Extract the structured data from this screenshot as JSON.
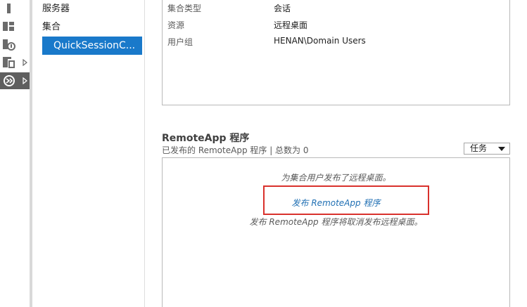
{
  "nav": {
    "items": [
      {
        "label": "服务器"
      },
      {
        "label": "集合"
      },
      {
        "label": "QuickSessionC..."
      }
    ]
  },
  "properties": {
    "rows": [
      {
        "key": "集合类型",
        "value": "会话"
      },
      {
        "key": "资源",
        "value": "远程桌面"
      },
      {
        "key": "用户组",
        "value": "HENAN\\Domain Users"
      }
    ]
  },
  "remoteapp": {
    "title": "RemoteApp 程序",
    "subtitle": "已发布的 RemoteApp 程序 | 总数为 0",
    "tasks_label": "任务",
    "message1": "为集合用户发布了远程桌面。",
    "publish_link": "发布 RemoteApp 程序",
    "message2": "发布 RemoteApp 程序将取消发布远程桌面。"
  },
  "colors": {
    "selection": "#1979ca",
    "link": "#1f6fb3",
    "highlight_border": "#d9312c"
  },
  "icons": [
    "dashboard-icon",
    "local-server-icon",
    "all-servers-icon",
    "file-storage-icon",
    "remote-desktop-services-icon"
  ]
}
